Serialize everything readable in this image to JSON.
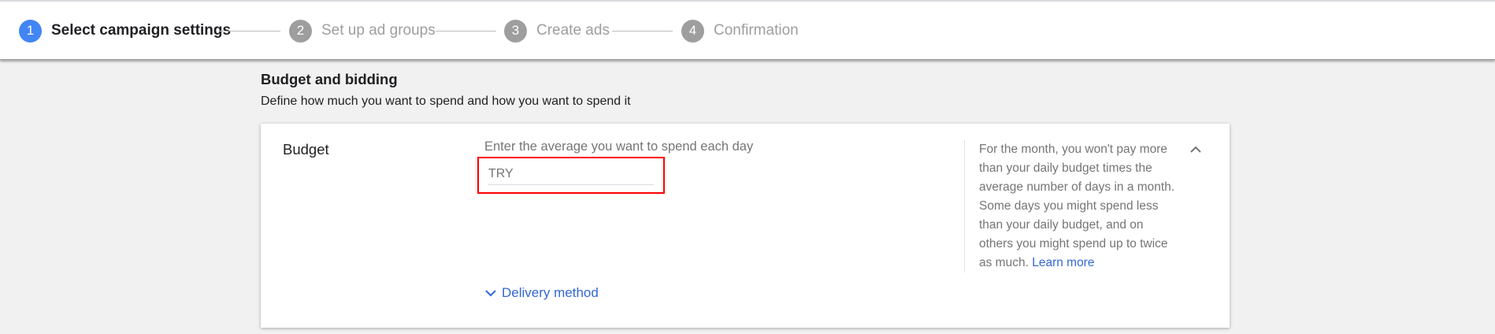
{
  "stepper": {
    "steps": [
      {
        "number": "1",
        "label": "Select campaign settings",
        "active": true
      },
      {
        "number": "2",
        "label": "Set up ad groups",
        "active": false
      },
      {
        "number": "3",
        "label": "Create ads",
        "active": false
      },
      {
        "number": "4",
        "label": "Confirmation",
        "active": false
      }
    ]
  },
  "section": {
    "title": "Budget and bidding",
    "description": "Define how much you want to spend and how you want to spend it"
  },
  "budget_card": {
    "title": "Budget",
    "hint": "Enter the average you want to spend each day",
    "input_placeholder": "TRY",
    "input_value": "",
    "delivery_method_label": "Delivery method",
    "help_text": "For the month, you won't pay more than your daily budget times the average number of days in a month. Some days you might spend less than your daily budget, and on others you might spend up to twice as much.",
    "learn_more_label": "Learn more"
  },
  "colors": {
    "accent": "#4285f4",
    "link": "#3367d6",
    "highlight": "#ff0000",
    "inactive_step": "#9e9e9e"
  },
  "icons": {
    "delivery_toggle": "chevron-down-icon",
    "card_toggle": "chevron-up-icon"
  }
}
